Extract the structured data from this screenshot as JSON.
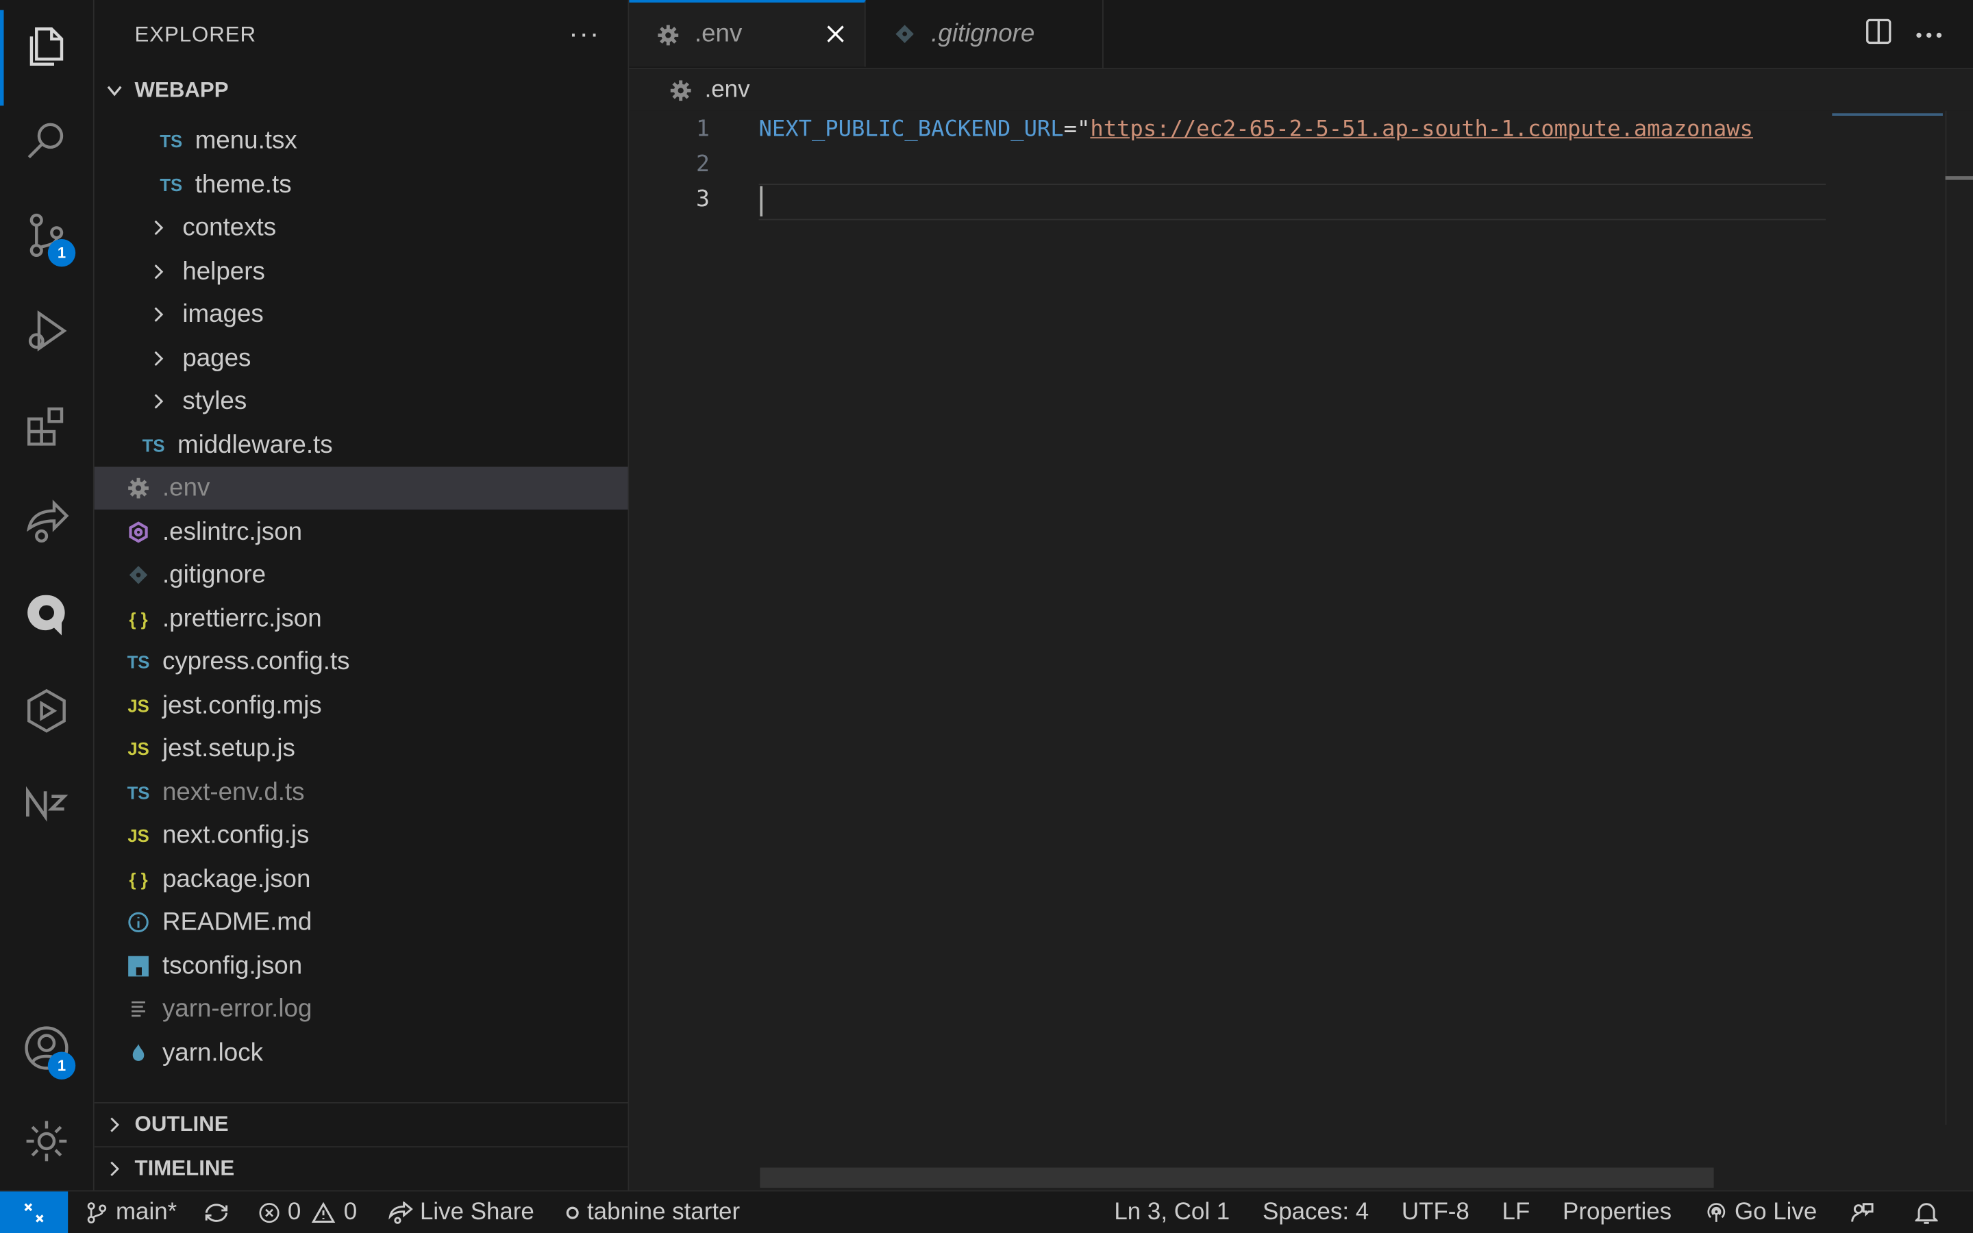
{
  "activity_bar": {
    "items": [
      {
        "name": "explorer-icon"
      },
      {
        "name": "search-icon"
      },
      {
        "name": "source-control-icon",
        "badge": "1"
      },
      {
        "name": "run-debug-icon"
      },
      {
        "name": "extensions-icon"
      },
      {
        "name": "live-share-icon"
      },
      {
        "name": "tabnine-icon"
      },
      {
        "name": "plugin-icon"
      },
      {
        "name": "nx-icon"
      },
      {
        "name": "accounts-icon",
        "badge": "1"
      },
      {
        "name": "gear-icon"
      }
    ]
  },
  "sidebar": {
    "title": "EXPLORER",
    "more": "···",
    "root": "WEBAPP",
    "tree": [
      {
        "label": "menu.tsx",
        "icon": "TS"
      },
      {
        "label": "theme.ts",
        "icon": "TS"
      },
      {
        "label": "contexts"
      },
      {
        "label": "helpers"
      },
      {
        "label": "images"
      },
      {
        "label": "pages"
      },
      {
        "label": "styles"
      },
      {
        "label": "middleware.ts",
        "icon": "TS"
      },
      {
        "label": ".env"
      },
      {
        "label": ".eslintrc.json"
      },
      {
        "label": ".gitignore"
      },
      {
        "label": ".prettierrc.json",
        "icon": "{ }"
      },
      {
        "label": "cypress.config.ts",
        "icon": "TS"
      },
      {
        "label": "jest.config.mjs",
        "icon": "JS"
      },
      {
        "label": "jest.setup.js",
        "icon": "JS"
      },
      {
        "label": "next-env.d.ts",
        "icon": "TS"
      },
      {
        "label": "next.config.js",
        "icon": "JS"
      },
      {
        "label": "package.json",
        "icon": "{ }"
      },
      {
        "label": "README.md"
      },
      {
        "label": "tsconfig.json",
        "icon": "TS"
      },
      {
        "label": "yarn-error.log"
      },
      {
        "label": "yarn.lock"
      }
    ],
    "outline": "OUTLINE",
    "timeline": "TIMELINE"
  },
  "tabs": [
    {
      "label": ".env",
      "active": true
    },
    {
      "label": ".gitignore",
      "active": false
    }
  ],
  "breadcrumb": ".env",
  "editor": {
    "line_numbers": [
      "1",
      "2",
      "3"
    ],
    "line1_key": "NEXT_PUBLIC_BACKEND_URL",
    "line1_op": "=\"",
    "line1_value": "https://ec2-65-2-5-51.ap-south-1.compute.amazonaws"
  },
  "status_bar": {
    "branch": "main*",
    "errors": "0",
    "warnings": "0",
    "live_share": "Live Share",
    "tabnine": "tabnine starter",
    "position": "Ln 3, Col 1",
    "spaces": "Spaces: 4",
    "encoding": "UTF-8",
    "eol": "LF",
    "language": "Properties",
    "go_live": "Go Live"
  },
  "colors": {
    "accent": "#0078d4",
    "ts_icon": "#519aba",
    "js_icon": "#cbcb41",
    "eslint_icon": "#a074c4",
    "string": "#ce9178",
    "key": "#569cd6"
  }
}
